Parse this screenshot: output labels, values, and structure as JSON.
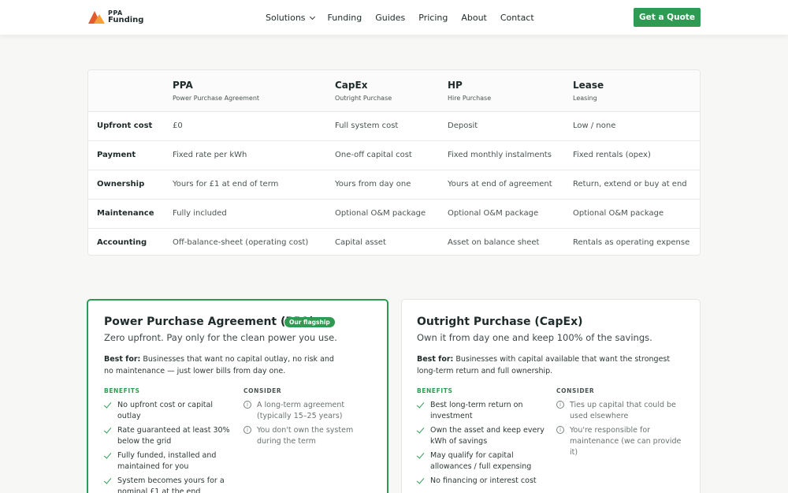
{
  "header": {
    "logo": {
      "line1": "PPA",
      "line2": "Funding"
    },
    "nav": [
      {
        "label": "Solutions",
        "has_dropdown": true
      },
      {
        "label": "Funding"
      },
      {
        "label": "Guides"
      },
      {
        "label": "Pricing"
      },
      {
        "label": "About"
      },
      {
        "label": "Contact"
      }
    ],
    "cta_label": "Get a Quote"
  },
  "colors": {
    "accent": "#2f9b52",
    "logo_orange": "#e55a2b",
    "logo_amber": "#f5a03a"
  },
  "comparison": {
    "columns": [
      {
        "title": "PPA",
        "subtitle": "Power Purchase Agreement"
      },
      {
        "title": "CapEx",
        "subtitle": "Outright Purchase"
      },
      {
        "title": "HP",
        "subtitle": "Hire Purchase"
      },
      {
        "title": "Lease",
        "subtitle": "Leasing"
      }
    ],
    "rows": [
      {
        "label": "Upfront cost",
        "cells": [
          "£0",
          "Full system cost",
          "Deposit",
          "Low / none"
        ]
      },
      {
        "label": "Payment",
        "cells": [
          "Fixed rate per kWh",
          "One-off capital cost",
          "Fixed monthly instalments",
          "Fixed rentals (opex)"
        ]
      },
      {
        "label": "Ownership",
        "cells": [
          "Yours for £1 at end of term",
          "Yours from day one",
          "Yours at end of agreement",
          "Return, extend or buy at end"
        ]
      },
      {
        "label": "Maintenance",
        "cells": [
          "Fully included",
          "Optional O&M package",
          "Optional O&M package",
          "Optional O&M package"
        ]
      },
      {
        "label": "Accounting",
        "cells": [
          "Off-balance-sheet (operating cost)",
          "Capital asset",
          "Asset on balance sheet",
          "Rentals as operating expense"
        ]
      }
    ]
  },
  "cards": {
    "ppa": {
      "title": "Power Purchase Agreement (PPA)",
      "badge": "Our flagship",
      "subtitle": "Zero upfront. Pay only for the clean power you use.",
      "best_for_label": "Best for:",
      "best_for": "Businesses that want no capital outlay, no risk and no maintenance — just lower bills from day one.",
      "benefits_label": "BENEFITS",
      "benefits": [
        "No upfront cost or capital outlay",
        "Rate guaranteed at least 30% below the grid",
        "Fully funded, installed and maintained for you",
        "System becomes yours for a nominal £1 at the end"
      ],
      "consider_label": "CONSIDER",
      "consider": [
        "A long-term agreement (typically 15–25 years)",
        "You don't own the system during the term"
      ]
    },
    "capex": {
      "title": "Outright Purchase (CapEx)",
      "subtitle": "Own it from day one and keep 100% of the savings.",
      "best_for_label": "Best for:",
      "best_for": "Businesses with capital available that want the strongest long-term return and full ownership.",
      "benefits_label": "BENEFITS",
      "benefits": [
        "Best long-term return on investment",
        "Own the asset and keep every kWh of savings",
        "May qualify for capital allowances / full expensing",
        "No financing or interest cost"
      ],
      "consider_label": "CONSIDER",
      "consider": [
        "Ties up capital that could be used elsewhere",
        "You're responsible for maintenance (we can provide it)"
      ]
    }
  }
}
